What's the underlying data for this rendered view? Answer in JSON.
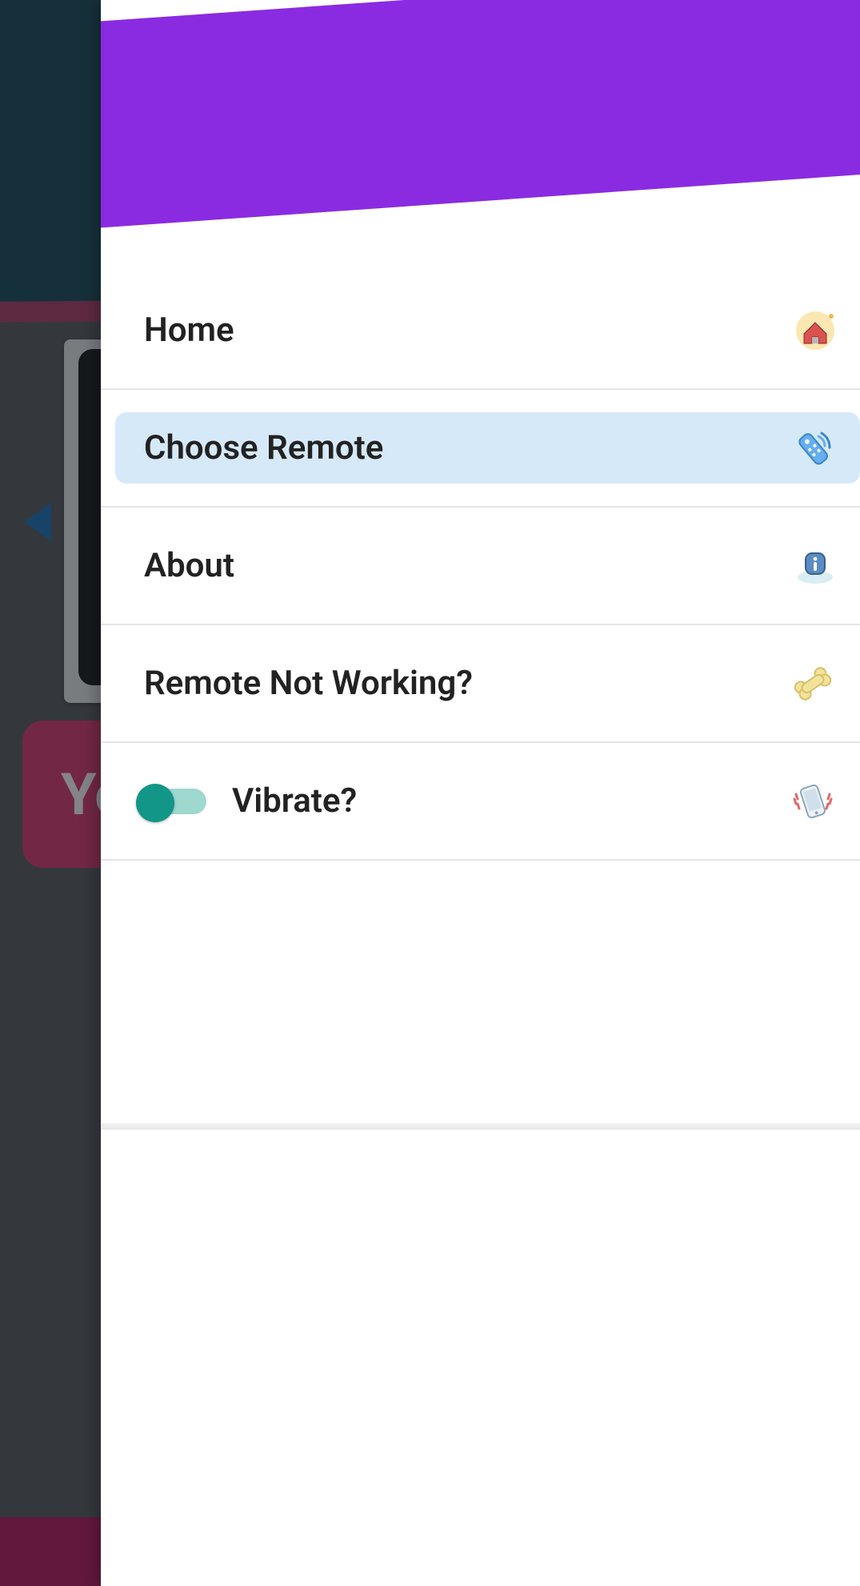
{
  "background": {
    "button_text": "Yo"
  },
  "drawer": {
    "menu": [
      {
        "key": "home",
        "label": "Home",
        "icon": "home-icon",
        "selected": false
      },
      {
        "key": "choose-remote",
        "label": "Choose Remote",
        "icon": "remote-icon",
        "selected": true
      },
      {
        "key": "about",
        "label": "About",
        "icon": "info-icon",
        "selected": false
      },
      {
        "key": "not-working",
        "label": "Remote Not Working?",
        "icon": "bone-icon",
        "selected": false
      }
    ],
    "vibrate": {
      "label": "Vibrate?",
      "enabled": true,
      "icon": "vibrate-icon"
    }
  },
  "colors": {
    "purple": "#8a2be2",
    "pink": "#ff2e92",
    "teal": "#119688",
    "selected_bg": "#d6e9f8",
    "bg_button": "#d9386f"
  }
}
